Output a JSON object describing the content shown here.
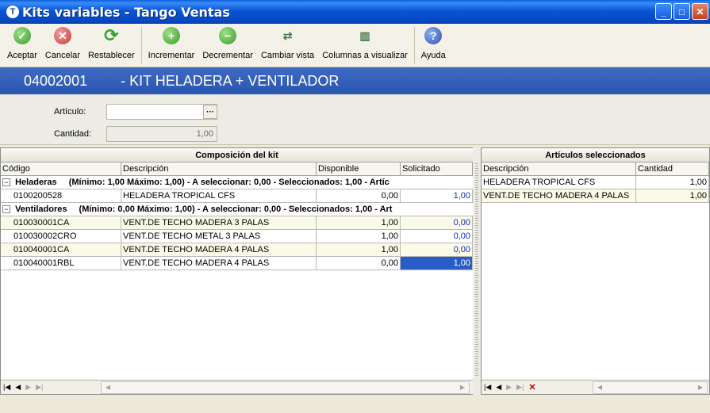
{
  "window": {
    "title": "Kits variables - Tango Ventas",
    "app_icon": "tango-icon"
  },
  "toolbar": {
    "aceptar": "Aceptar",
    "cancelar": "Cancelar",
    "restablecer": "Restablecer",
    "incrementar": "Incrementar",
    "decrementar": "Decrementar",
    "cambiar_vista": "Cambiar vista",
    "columnas": "Columnas a visualizar",
    "ayuda": "Ayuda"
  },
  "kit": {
    "code": "04002001",
    "description": "- KIT HELADERA + VENTILADOR"
  },
  "form": {
    "articulo_label": "Artículo:",
    "articulo_value": "",
    "cantidad_label": "Cantidad:",
    "cantidad_value": "1,00"
  },
  "composition": {
    "title": "Composición del kit",
    "columns": [
      "Código",
      "Descripción",
      "Disponible",
      "Solicitado"
    ],
    "groups": [
      {
        "name": "Heladeras",
        "info": "(Mínimo: 1,00 Máximo: 1,00)  -  A seleccionar: 0,00  -  Seleccionados: 1,00  -  Artíc",
        "rows": [
          {
            "code": "0100200528",
            "desc": "HELADERA TROPICAL CFS",
            "disp": "0,00",
            "sol": "1,00"
          }
        ]
      },
      {
        "name": "Ventiladores",
        "info": "(Mínimo: 0,00 Máximo: 1,00)  -  A seleccionar: 0,00  -  Seleccionados: 1,00  -  Art",
        "rows": [
          {
            "code": "010030001CA",
            "desc": "VENT.DE TECHO MADERA 3 PALAS",
            "disp": "1,00",
            "sol": "0,00"
          },
          {
            "code": "010030002CRO",
            "desc": "VENT.DE TECHO METAL 3 PALAS",
            "disp": "1,00",
            "sol": "0,00"
          },
          {
            "code": "010040001CA",
            "desc": "VENT.DE TECHO MADERA 4 PALAS",
            "disp": "1,00",
            "sol": "0,00"
          },
          {
            "code": "010040001RBL",
            "desc": "VENT.DE TECHO MADERA 4 PALAS",
            "disp": "0,00",
            "sol": "1,00"
          }
        ]
      }
    ]
  },
  "selected": {
    "title": "Artículos seleccionados",
    "columns": [
      "Descripción",
      "Cantidad"
    ],
    "rows": [
      {
        "desc": "HELADERA TROPICAL CFS",
        "qty": "1,00"
      },
      {
        "desc": "VENT.DE TECHO MADERA 4 PALAS",
        "qty": "1,00"
      }
    ]
  }
}
